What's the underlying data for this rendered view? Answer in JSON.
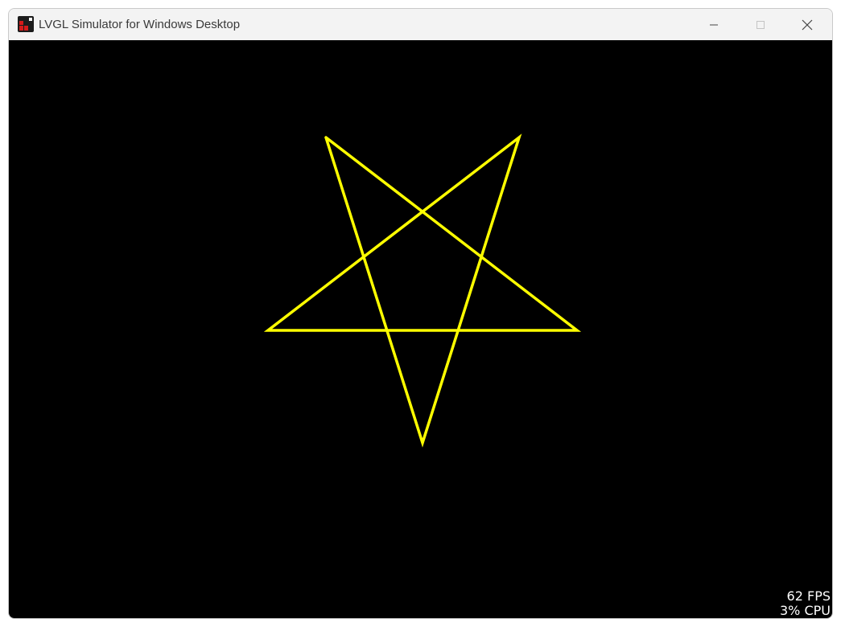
{
  "window": {
    "title": "LVGL Simulator for Windows Desktop",
    "icon": "lvgl-logo-icon",
    "controls": [
      "minimize-icon",
      "maximize-icon",
      "close-icon"
    ]
  },
  "canvas": {
    "background_color": "#000000",
    "shape": {
      "type": "pentagram",
      "stroke_color": "#ffff00"
    }
  },
  "perf_monitor": {
    "fps_text": "62 FPS",
    "cpu_text": "3% CPU",
    "color": "#ffffff"
  }
}
